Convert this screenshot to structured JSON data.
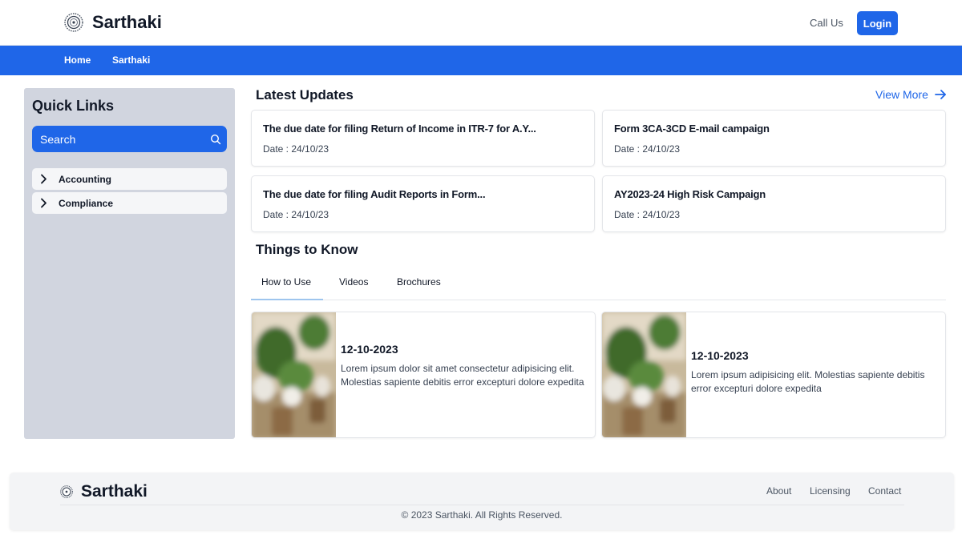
{
  "header": {
    "brand": "Sarthaki",
    "call_us": "Call Us",
    "login": "Login"
  },
  "nav": {
    "items": [
      {
        "label": "Home"
      },
      {
        "label": "Sarthaki"
      }
    ]
  },
  "sidebar": {
    "title": "Quick Links",
    "search_placeholder": "Search",
    "items": [
      {
        "label": "Accounting"
      },
      {
        "label": "Compliance"
      }
    ]
  },
  "updates": {
    "title": "Latest Updates",
    "view_more": "View More",
    "cards": [
      {
        "title": "The due date for filing Return of Income in ITR-7 for A.Y...",
        "date": "Date : 24/10/23"
      },
      {
        "title": "Form 3CA-3CD E-mail campaign",
        "date": "Date : 24/10/23"
      },
      {
        "title": "The due date for filing Audit Reports in Form...",
        "date": "Date : 24/10/23"
      },
      {
        "title": "AY2023-24 High Risk Campaign",
        "date": "Date : 24/10/23"
      }
    ]
  },
  "things": {
    "title": "Things to Know",
    "tabs": [
      {
        "label": "How to Use"
      },
      {
        "label": "Videos"
      },
      {
        "label": "Brochures"
      }
    ],
    "active_tab": "How to Use",
    "cards": [
      {
        "date": "12-10-2023",
        "text": "Lorem ipsum dolor sit amet consectetur adipisicing elit. Molestias sapiente debitis error excepturi dolore expedita"
      },
      {
        "date": "12-10-2023",
        "text": "Lorem ipsum adipisicing elit. Molestias sapiente debitis error excepturi dolore expedita"
      }
    ]
  },
  "footer": {
    "brand": "Sarthaki",
    "links": [
      {
        "label": "About"
      },
      {
        "label": "Licensing"
      },
      {
        "label": "Contact"
      }
    ],
    "copyright": "© 2023 Sarthaki. All Rights Reserved."
  },
  "colors": {
    "primary": "#1f66e8",
    "sidebar_bg": "#d1d5df",
    "footer_bg": "#f3f4f6"
  },
  "icons": [
    "emblem-logo-icon",
    "search-icon",
    "chevron-right-icon",
    "arrow-right-icon"
  ]
}
